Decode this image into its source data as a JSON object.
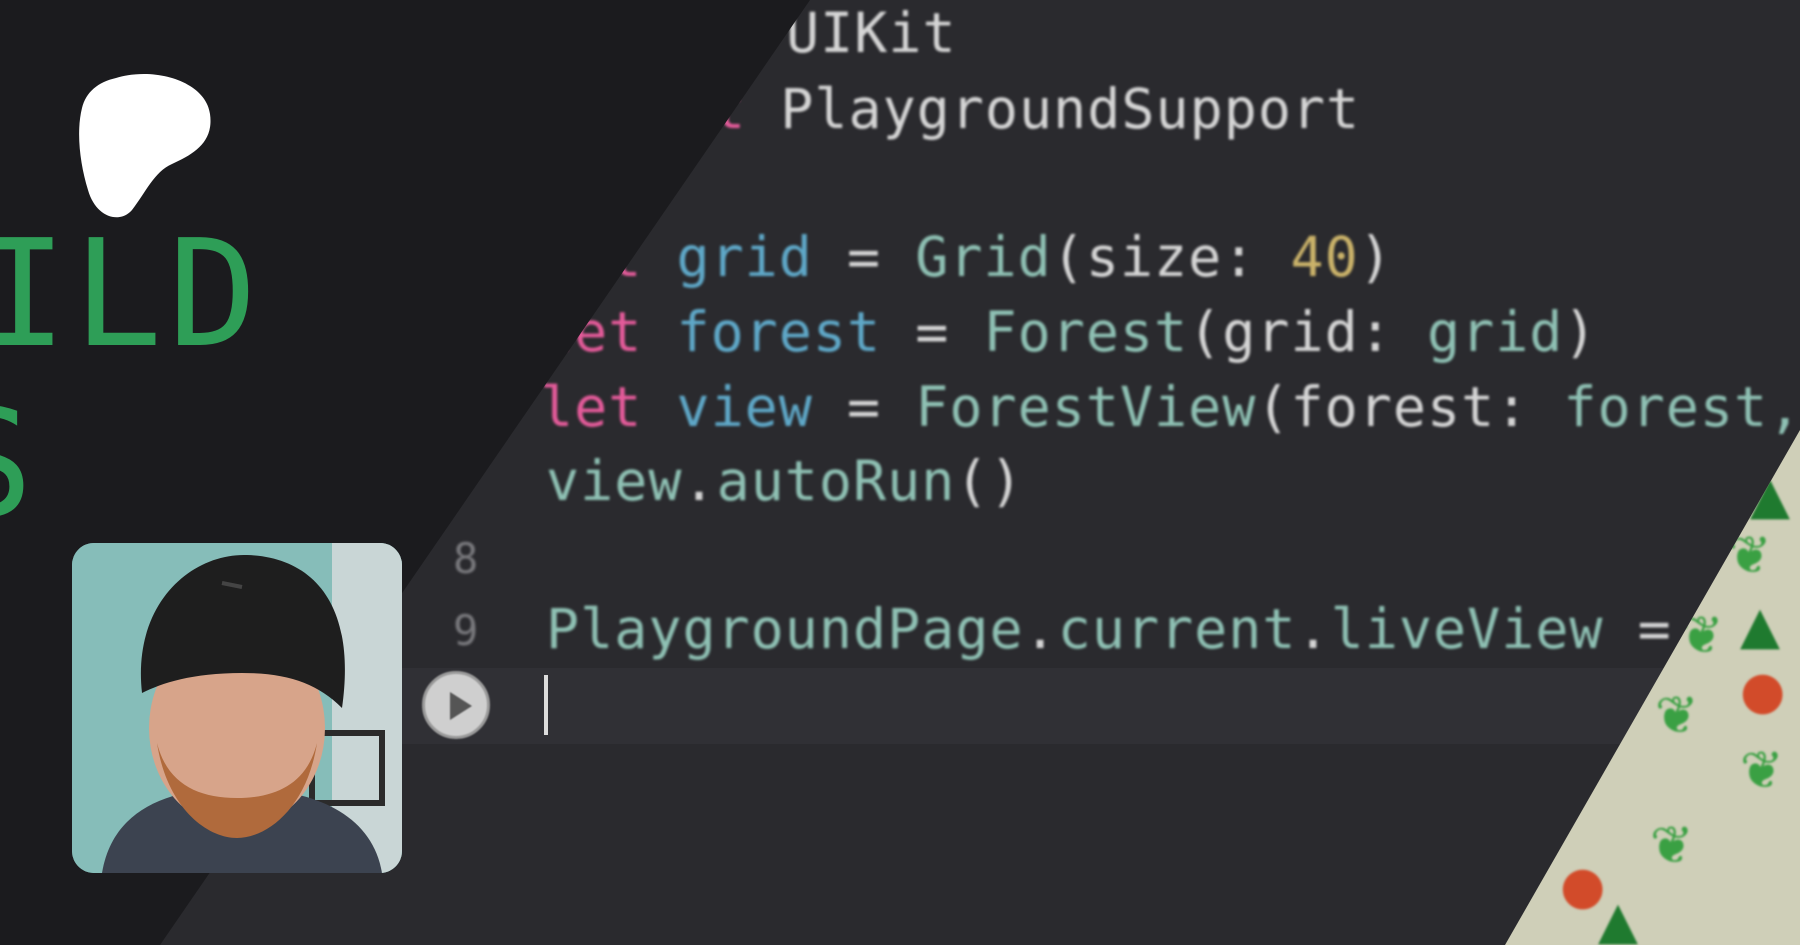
{
  "code_lines": [
    {
      "segments": [
        {
          "text": "UIKit",
          "cls": "pl"
        }
      ]
    },
    {
      "segments": [
        {
          "text": "t ",
          "cls": "kw"
        },
        {
          "text": "PlaygroundSupport",
          "cls": "pl"
        }
      ]
    },
    {
      "segments": []
    },
    {
      "segments": [
        {
          "text": "let ",
          "cls": "kw"
        },
        {
          "text": "grid",
          "cls": "id"
        },
        {
          "text": " = ",
          "cls": "pl"
        },
        {
          "text": "Grid",
          "cls": "tp"
        },
        {
          "text": "(size: ",
          "cls": "pl"
        },
        {
          "text": "40",
          "cls": "nm"
        },
        {
          "text": ")",
          "cls": "pl"
        }
      ]
    },
    {
      "segments": [
        {
          "text": "let ",
          "cls": "kw"
        },
        {
          "text": "forest",
          "cls": "id"
        },
        {
          "text": " = ",
          "cls": "pl"
        },
        {
          "text": "Forest",
          "cls": "tp"
        },
        {
          "text": "(grid: ",
          "cls": "pl"
        },
        {
          "text": "grid",
          "cls": "tp"
        },
        {
          "text": ")",
          "cls": "pl"
        }
      ]
    },
    {
      "segments": [
        {
          "text": "let ",
          "cls": "kw"
        },
        {
          "text": "view",
          "cls": "id"
        },
        {
          "text": " = ",
          "cls": "pl"
        },
        {
          "text": "ForestView",
          "cls": "tp"
        },
        {
          "text": "(forest: ",
          "cls": "pl"
        },
        {
          "text": "forest,",
          "cls": "tp"
        }
      ]
    },
    {
      "segments": [
        {
          "text": "view",
          "cls": "tp"
        },
        {
          "text": ".",
          "cls": "pl"
        },
        {
          "text": "autoRun",
          "cls": "tp"
        },
        {
          "text": "()",
          "cls": "pl"
        }
      ]
    },
    {
      "segments": []
    },
    {
      "segments": [
        {
          "text": "PlaygroundPage",
          "cls": "tp"
        },
        {
          "text": ".",
          "cls": "pl"
        },
        {
          "text": "current",
          "cls": "tp"
        },
        {
          "text": ".",
          "cls": "pl"
        },
        {
          "text": "liveView",
          "cls": "tp"
        },
        {
          "text": " =",
          "cls": "pl"
        }
      ]
    }
  ],
  "line_numbers": {
    "eight": "8",
    "nine": "9"
  },
  "brand": {
    "line1": "ILD",
    "line2": "S"
  },
  "icons": {
    "logo": "patreon-logo-icon",
    "run": "play-icon"
  },
  "colors": {
    "keyword": "#e45b9a",
    "identifier": "#5fa8c8",
    "type": "#8fc1b4",
    "number": "#cbb36a",
    "brand_green": "#2e9e57"
  }
}
